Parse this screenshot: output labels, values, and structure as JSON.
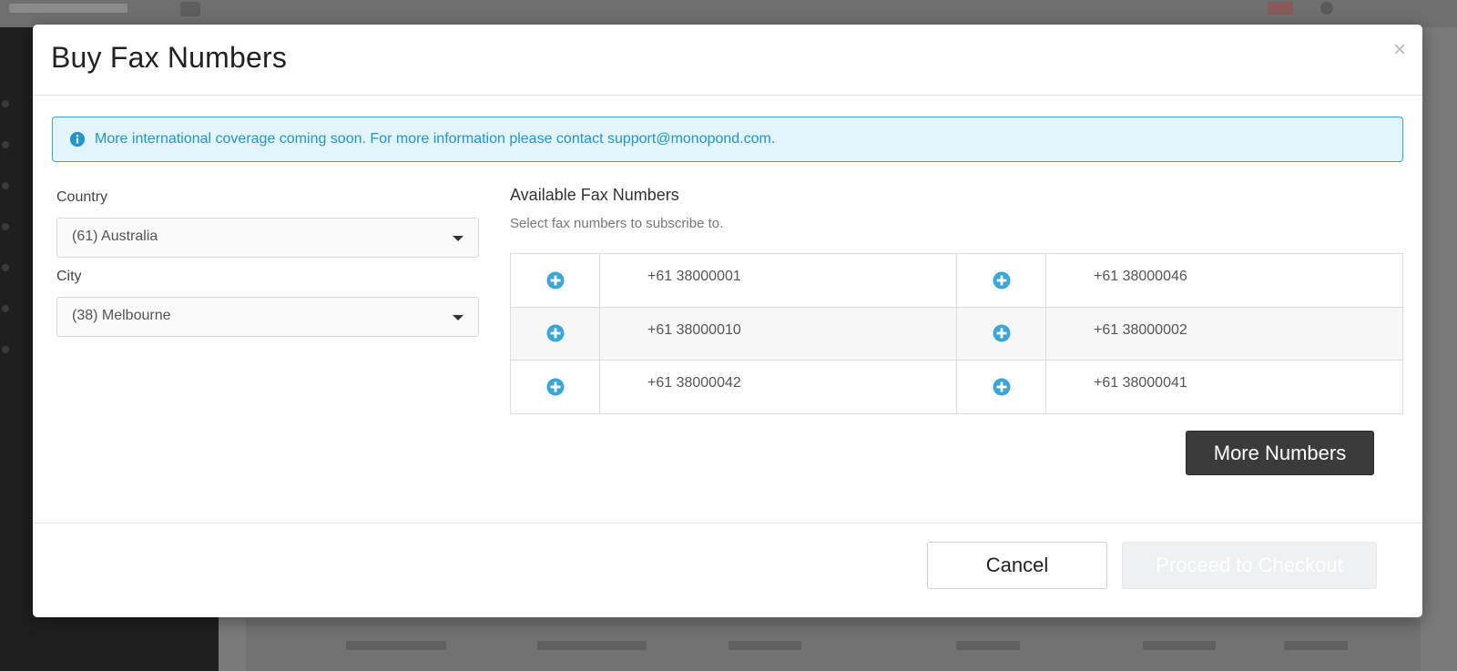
{
  "modal": {
    "title": "Buy Fax Numbers",
    "close_glyph": "×"
  },
  "alert": {
    "icon": "info-circle-icon",
    "text": "More international coverage coming soon. For more information please contact support@monopond.com."
  },
  "country": {
    "label": "Country",
    "value": "(61) Australia"
  },
  "city": {
    "label": "City",
    "value": "(38) Melbourne"
  },
  "available": {
    "title": "Available Fax Numbers",
    "subtitle": "Select fax numbers to subscribe to.",
    "rows": [
      [
        "+61 38000001",
        "+61 38000046"
      ],
      [
        "+61 38000010",
        "+61 38000002"
      ],
      [
        "+61 38000042",
        "+61 38000041"
      ]
    ]
  },
  "buttons": {
    "more_numbers": "More Numbers",
    "cancel": "Cancel",
    "checkout": "Proceed to Checkout"
  },
  "colors": {
    "accent": "#3aa6d6",
    "alert_bg": "#e3f4fa",
    "dark_button": "#3b3b3b",
    "disabled_button": "#eef0f1"
  }
}
